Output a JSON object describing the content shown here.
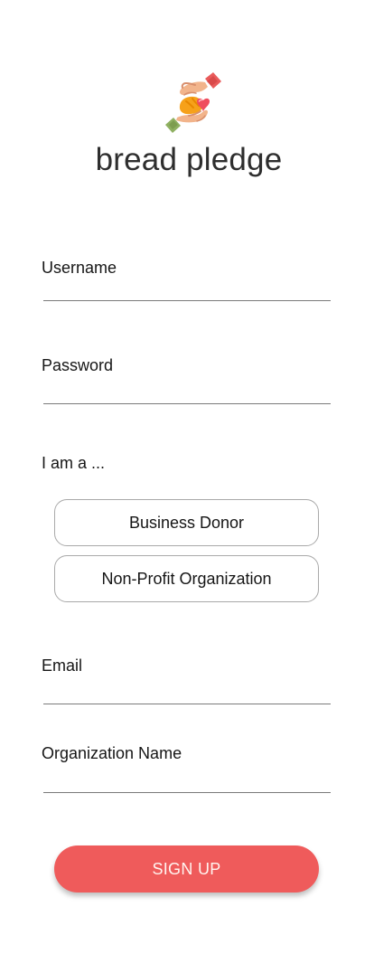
{
  "app": {
    "title": "bread pledge",
    "logo_icon": "hands-heart-bread-icon"
  },
  "form": {
    "username_label": "Username",
    "username_value": "",
    "password_label": "Password",
    "password_value": "",
    "role_label": "I am a ...",
    "role_options": [
      "Business Donor",
      "Non-Profit Organization"
    ],
    "email_label": "Email",
    "email_value": "",
    "organization_label": "Organization Name",
    "organization_value": "",
    "submit_label": "SIGN UP"
  },
  "colors": {
    "accent": "#EF5B5B",
    "submit_text": "#FFF4F0",
    "field_border": "#7A7A7A",
    "option_border": "#A9A9A9",
    "text": "#161616"
  }
}
